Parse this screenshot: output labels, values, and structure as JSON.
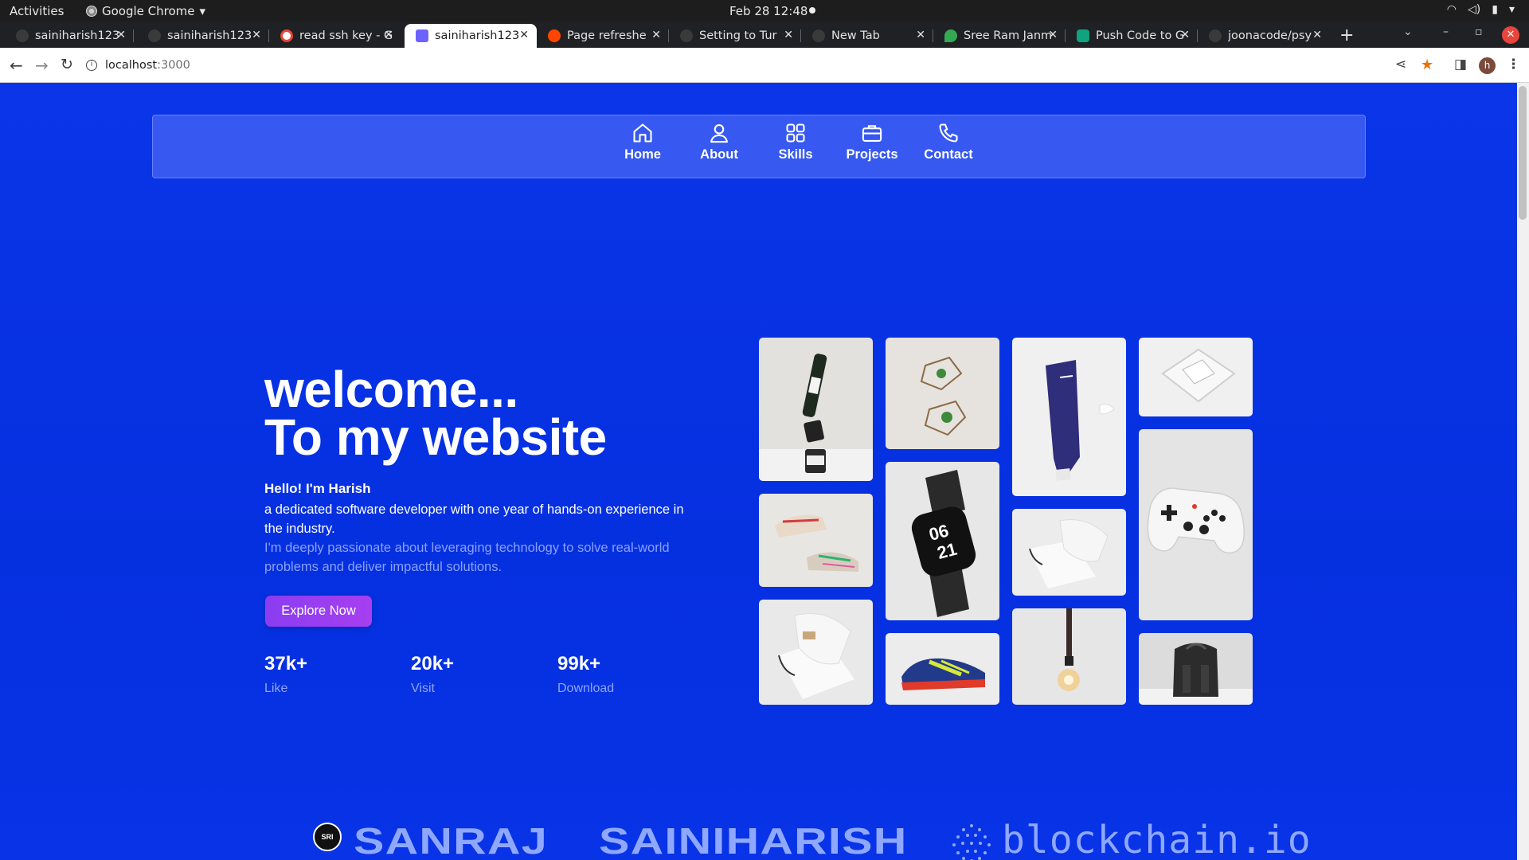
{
  "os": {
    "activities": "Activities",
    "app_name": "Google Chrome",
    "clock": "Feb 28  12:48"
  },
  "browser": {
    "tabs": [
      {
        "label": "sainiharish123",
        "fav_color": "#3a3a3a",
        "active": false
      },
      {
        "label": "sainiharish123",
        "fav_color": "#3a3a3a",
        "active": false
      },
      {
        "label": "read ssh key - G",
        "fav_color": "#ea4335",
        "active": false
      },
      {
        "label": "sainiharish123",
        "fav_color": "#6c63ff",
        "active": true
      },
      {
        "label": "Page refreshe",
        "fav_color": "#ff4500",
        "active": false
      },
      {
        "label": "Setting to Tur",
        "fav_color": "#3a3a3a",
        "active": false
      },
      {
        "label": "New Tab",
        "fav_color": "#3a3a3a",
        "active": false
      },
      {
        "label": "Sree Ram Janm",
        "fav_color": "#34a853",
        "active": false
      },
      {
        "label": "Push Code to G",
        "fav_color": "#10a37f",
        "active": false
      },
      {
        "label": "joonacode/psy",
        "fav_color": "#3a3a3a",
        "active": false
      }
    ],
    "new_tab": "+",
    "url_host": "localhost",
    "url_port": ":3000",
    "profile_initial": "h"
  },
  "site": {
    "nav": [
      {
        "label": "Home",
        "icon": "home-icon"
      },
      {
        "label": "About",
        "icon": "user-icon"
      },
      {
        "label": "Skills",
        "icon": "grid-icon"
      },
      {
        "label": "Projects",
        "icon": "briefcase-icon"
      },
      {
        "label": "Contact",
        "icon": "phone-icon"
      }
    ],
    "hero": {
      "title_line1": "welcome...",
      "title_line2": "To my website",
      "hello": "Hello! I'm Harish",
      "intro": "a dedicated software developer with one year of hands-on experience in the industry.",
      "passion": "I'm deeply passionate about leveraging technology to solve real-world problems and deliver impactful solutions.",
      "cta": "Explore Now"
    },
    "stats": [
      {
        "value": "37k+",
        "label": "Like"
      },
      {
        "value": "20k+",
        "label": "Visit"
      },
      {
        "value": "99k+",
        "label": "Download"
      }
    ],
    "products": [
      "bottles-image",
      "plant-holders-image",
      "cream-tube-image",
      "glass-box-image",
      "sneakers-image",
      "smartwatch-image",
      "pouch-image",
      "game-controller-image",
      "paper-bag-image",
      "running-shoe-image",
      "pendant-lamp-image",
      "backpack-image"
    ],
    "brands": {
      "badge": "SRI",
      "brand1": "SANRAJ",
      "brand2": "SAINIHARISH",
      "brand3": "blockchain.io"
    },
    "colors": {
      "page_bg": "#0a33e6",
      "accent": "#9b3ef0",
      "muted_text": "#8aa0ff"
    }
  }
}
